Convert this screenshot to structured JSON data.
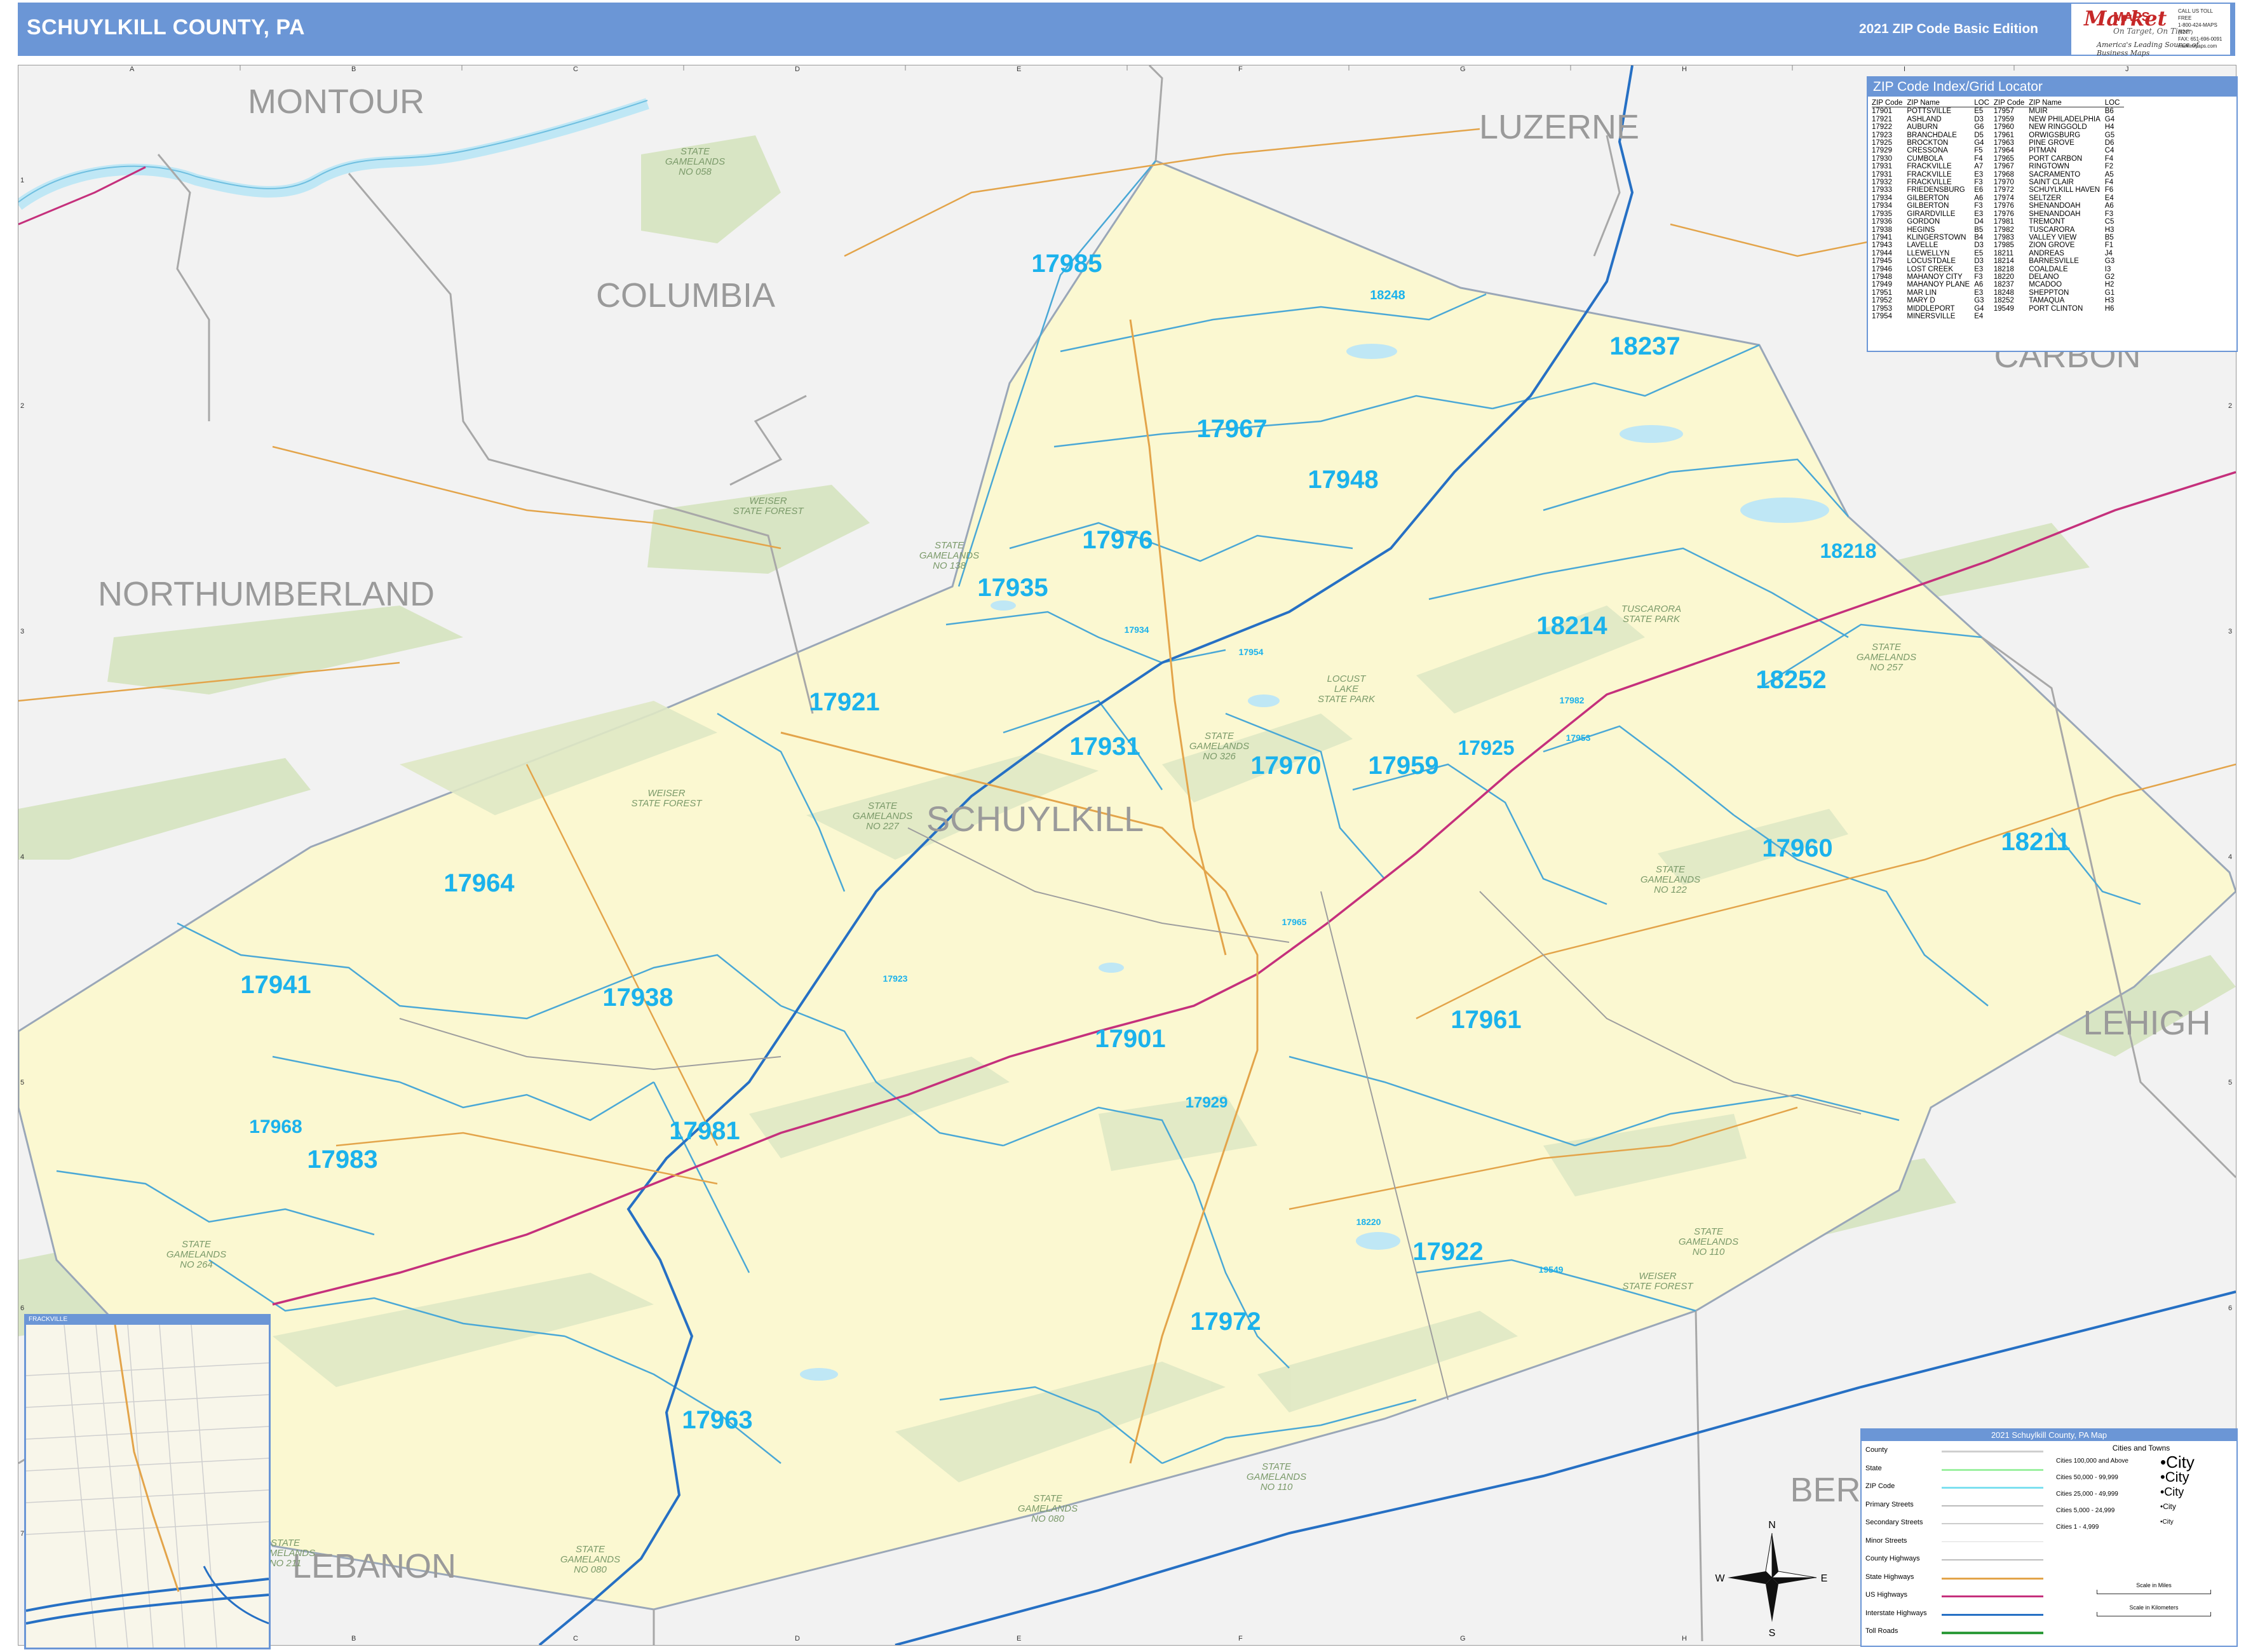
{
  "header": {
    "title": "SCHUYLKILL COUNTY, PA",
    "edition": "2021 ZIP Code Basic Edition"
  },
  "logo": {
    "brand_prefix": "Market",
    "brand_main": "MAPS",
    "tagline": "On Target, On Time",
    "tagline2": "America's Leading Source of Business Maps",
    "contact": [
      "CALL US TOLL FREE",
      "1-800-424-MAPS (6277)",
      "FAX: 651-696-0091",
      "marketmaps.com"
    ]
  },
  "map": {
    "county_name": "SCHUYLKILL",
    "neighbor_counties": [
      "MONTOUR",
      "LUZERNE",
      "COLUMBIA",
      "CARBON",
      "NORTHUMBERLAND",
      "LEHIGH",
      "BERKS",
      "LEBANON"
    ],
    "zip_labels": [
      {
        "text": "17985"
      },
      {
        "text": "18248"
      },
      {
        "text": "18237"
      },
      {
        "text": "17967"
      },
      {
        "text": "17948"
      },
      {
        "text": "17976"
      },
      {
        "text": "17935"
      },
      {
        "text": "18218"
      },
      {
        "text": "18214"
      },
      {
        "text": "18252"
      },
      {
        "text": "17921"
      },
      {
        "text": "17931"
      },
      {
        "text": "17970"
      },
      {
        "text": "17959"
      },
      {
        "text": "17925"
      },
      {
        "text": "17960"
      },
      {
        "text": "18211"
      },
      {
        "text": "17964"
      },
      {
        "text": "17941"
      },
      {
        "text": "17938"
      },
      {
        "text": "17901"
      },
      {
        "text": "17961"
      },
      {
        "text": "17968"
      },
      {
        "text": "17983"
      },
      {
        "text": "17981"
      },
      {
        "text": "17929"
      },
      {
        "text": "17922"
      },
      {
        "text": "17972"
      },
      {
        "text": "17963"
      },
      {
        "text": "18220"
      },
      {
        "text": "17982"
      },
      {
        "text": "17953"
      },
      {
        "text": "17934"
      },
      {
        "text": "17965"
      },
      {
        "text": "17954"
      },
      {
        "text": "17923"
      },
      {
        "text": "19549"
      }
    ],
    "area_labels": [
      {
        "text": "STATE GAMELANDS NO 058"
      },
      {
        "text": "WEISER STATE FOREST"
      },
      {
        "text": "STATE GAMELANDS NO 138"
      },
      {
        "text": "TUSCARORA STATE PARK"
      },
      {
        "text": "STATE GAMELANDS NO 257"
      },
      {
        "text": "LOCUST LAKE STATE PARK"
      },
      {
        "text": "STATE GAMELANDS NO 326"
      },
      {
        "text": "WEISER STATE FOREST"
      },
      {
        "text": "STATE GAMELANDS NO 227"
      },
      {
        "text": "STATE GAMELANDS NO 122"
      },
      {
        "text": "STATE GAMELANDS NO 264"
      },
      {
        "text": "STATE GAMELANDS NO 110"
      },
      {
        "text": "WEISER STATE FOREST"
      },
      {
        "text": "STATE GAMELANDS NO 080"
      },
      {
        "text": "STATE GAMELANDS NO 211"
      },
      {
        "text": "STATE GAMELANDS NO 080"
      },
      {
        "text": "STATE GAMELANDS NO 110"
      }
    ],
    "grid_columns": [
      "A",
      "B",
      "C",
      "D",
      "E",
      "F",
      "G",
      "H",
      "I",
      "J"
    ],
    "grid_rows": [
      "1",
      "2",
      "3",
      "4",
      "5",
      "6",
      "7"
    ]
  },
  "zip_index": {
    "title": "ZIP Code Index/Grid Locator",
    "columns": [
      "ZIP Code",
      "ZIP Name",
      "LOC",
      "ZIP Code",
      "ZIP Name",
      "LOC"
    ],
    "rows": [
      [
        "17901",
        "POTTSVILLE",
        "E5",
        "17957",
        "MUIR",
        "B6"
      ],
      [
        "17921",
        "ASHLAND",
        "D3",
        "17959",
        "NEW PHILADELPHIA",
        "G4"
      ],
      [
        "17922",
        "AUBURN",
        "G6",
        "17960",
        "NEW RINGGOLD",
        "H4"
      ],
      [
        "17923",
        "BRANCHDALE",
        "D5",
        "17961",
        "ORWIGSBURG",
        "G5"
      ],
      [
        "17925",
        "BROCKTON",
        "G4",
        "17963",
        "PINE GROVE",
        "D6"
      ],
      [
        "17929",
        "CRESSONA",
        "F5",
        "17964",
        "PITMAN",
        "C4"
      ],
      [
        "17930",
        "CUMBOLA",
        "F4",
        "17965",
        "PORT CARBON",
        "F4"
      ],
      [
        "17931",
        "FRACKVILLE",
        "A7",
        "17967",
        "RINGTOWN",
        "F2"
      ],
      [
        "17931",
        "FRACKVILLE",
        "E3",
        "17968",
        "SACRAMENTO",
        "A5"
      ],
      [
        "17932",
        "FRACKVILLE",
        "F3",
        "17970",
        "SAINT CLAIR",
        "F4"
      ],
      [
        "17933",
        "FRIEDENSBURG",
        "E6",
        "17972",
        "SCHUYLKILL HAVEN",
        "F6"
      ],
      [
        "17934",
        "GILBERTON",
        "A6",
        "17974",
        "SELTZER",
        "E4"
      ],
      [
        "17934",
        "GILBERTON",
        "F3",
        "17976",
        "SHENANDOAH",
        "A6"
      ],
      [
        "17935",
        "GIRARDVILLE",
        "E3",
        "17976",
        "SHENANDOAH",
        "F3"
      ],
      [
        "17936",
        "GORDON",
        "D4",
        "17981",
        "TREMONT",
        "C5"
      ],
      [
        "17938",
        "HEGINS",
        "B5",
        "17982",
        "TUSCARORA",
        "H3"
      ],
      [
        "17941",
        "KLINGERSTOWN",
        "B4",
        "17983",
        "VALLEY VIEW",
        "B5"
      ],
      [
        "17943",
        "LAVELLE",
        "D3",
        "17985",
        "ZION GROVE",
        "F1"
      ],
      [
        "17944",
        "LLEWELLYN",
        "E5",
        "18211",
        "ANDREAS",
        "J4"
      ],
      [
        "17945",
        "LOCUSTDALE",
        "D3",
        "18214",
        "BARNESVILLE",
        "G3"
      ],
      [
        "17946",
        "LOST CREEK",
        "E3",
        "18218",
        "COALDALE",
        "I3"
      ],
      [
        "17948",
        "MAHANOY CITY",
        "F3",
        "18220",
        "DELANO",
        "G2"
      ],
      [
        "17949",
        "MAHANOY PLANE",
        "A6",
        "18237",
        "MCADOO",
        "H2"
      ],
      [
        "17951",
        "MAR LIN",
        "E3",
        "18248",
        "SHEPPTON",
        "G1"
      ],
      [
        "17952",
        "MARY D",
        "G3",
        "18252",
        "TAMAQUA",
        "H3"
      ],
      [
        "17953",
        "MIDDLEPORT",
        "G4",
        "19549",
        "PORT CLINTON",
        "H6"
      ],
      [
        "17954",
        "MINERSVILLE",
        "E4",
        "",
        "",
        ""
      ]
    ]
  },
  "legend": {
    "title": "2021 Schuylkill County, PA Map",
    "left_items": [
      "County",
      "State",
      "ZIP Code",
      "Primary Streets",
      "Secondary Streets",
      "Minor Streets",
      "County Highways",
      "State Highways",
      "US Highways",
      "Interstate Highways",
      "Toll Roads"
    ],
    "cities_title": "Cities and Towns",
    "city_sizes": [
      {
        "range": "Cities 100,000 and Above",
        "sample": "City"
      },
      {
        "range": "Cities 50,000 - 99,999",
        "sample": "City"
      },
      {
        "range": "Cities 25,000 - 49,999",
        "sample": "City"
      },
      {
        "range": "Cities 5,000 - 24,999",
        "sample": "City"
      },
      {
        "range": "Cities 1 - 4,999",
        "sample": "City"
      }
    ],
    "scale_miles": "Scale in Miles",
    "scale_km": "Scale in Kilometers"
  },
  "inset": {
    "title": "FRACKVILLE"
  },
  "compass": {
    "n": "N",
    "s": "S",
    "e": "E",
    "w": "W"
  },
  "colors": {
    "header": "#6b96d6",
    "county_fill": "#fbf8d1",
    "outside_fill": "#f2f2f2",
    "forest": "#d8e5c4",
    "zip_boundary": "#4aa8d6",
    "zip_label": "#1bb2ec",
    "neighbor_label": "#9a9a9a",
    "interstate": "#2670c4",
    "us_highway": "#c5307c",
    "state_highway": "#e3a44a",
    "water": "#bfe7f5"
  }
}
